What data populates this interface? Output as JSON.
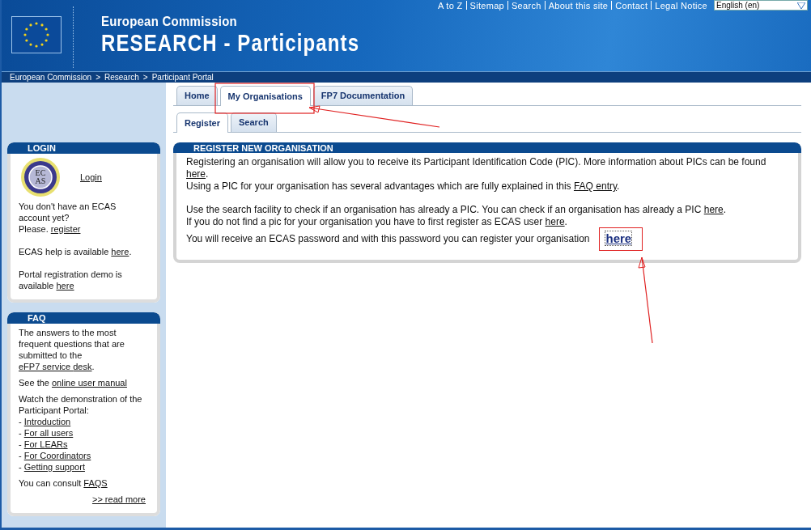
{
  "header": {
    "top_links": [
      "A to Z",
      "Sitemap",
      "Search",
      "About this site",
      "Contact",
      "Legal Notice"
    ],
    "language": "English (en)",
    "title_small": "European Commission",
    "title_large": "RESEARCH - Participants"
  },
  "breadcrumb": [
    "European Commission",
    "Research",
    "Participant Portal"
  ],
  "breadcrumb_separator": ">",
  "tabs": [
    {
      "label": "Home",
      "selected": false
    },
    {
      "label": "My Organisations",
      "selected": true
    },
    {
      "label": "FP7 Documentation",
      "selected": false
    }
  ],
  "subtabs": [
    {
      "label": "Register",
      "selected": true
    },
    {
      "label": "Search",
      "selected": false
    }
  ],
  "login": {
    "title": "LOGIN",
    "logo_text": [
      "EC",
      "AS"
    ],
    "login_link": "Login",
    "blocks": [
      [
        [
          {
            "kind": "text",
            "text": "You don't have an ECAS account yet?"
          }
        ],
        [
          {
            "kind": "text",
            "text": "Please. "
          },
          {
            "kind": "link",
            "text": "register"
          }
        ]
      ],
      [
        [
          {
            "kind": "text",
            "text": "ECAS help is available "
          },
          {
            "kind": "link",
            "text": "here"
          },
          {
            "kind": "text",
            "text": "."
          }
        ]
      ],
      [
        [
          {
            "kind": "text",
            "text": "Portal registration demo is available "
          },
          {
            "kind": "link",
            "text": "here"
          }
        ]
      ]
    ]
  },
  "faq": {
    "title": "FAQ",
    "blocks": [
      [
        [
          {
            "kind": "text",
            "text": "The answers to the most frequent questions that are submitted to the "
          },
          {
            "kind": "link",
            "text": "eFP7 service "
          },
          {
            "kind": "link",
            "text": "desk"
          },
          {
            "kind": "text",
            "text": "."
          }
        ]
      ],
      [
        [
          {
            "kind": "text",
            "text": "See the "
          },
          {
            "kind": "link",
            "text": "online user manual"
          }
        ]
      ],
      [
        [
          {
            "kind": "text",
            "text": "Watch the demonstration of the Participant Portal:"
          }
        ],
        [
          {
            "kind": "text",
            "text": "- "
          },
          {
            "kind": "link",
            "text": "Introduction"
          }
        ],
        [
          {
            "kind": "text",
            "text": "- "
          },
          {
            "kind": "link",
            "text": "For all users"
          }
        ],
        [
          {
            "kind": "text",
            "text": "- "
          },
          {
            "kind": "link",
            "text": "For LEARs"
          }
        ],
        [
          {
            "kind": "text",
            "text": "- "
          },
          {
            "kind": "link",
            "text": "For Coordinators"
          }
        ],
        [
          {
            "kind": "text",
            "text": "- "
          },
          {
            "kind": "link",
            "text": "Getting support"
          }
        ]
      ],
      [
        [
          {
            "kind": "text",
            "text": "You can consult "
          },
          {
            "kind": "link",
            "text": "FAQS"
          }
        ]
      ]
    ],
    "read_more": ">> read more"
  },
  "panel": {
    "title": "REGISTER NEW ORGANISATION",
    "blocks": [
      [
        [
          {
            "kind": "text",
            "text": "Registering an organisation will allow you to receive its Participant Identification Code (PIC). More information about PICs can be found "
          },
          {
            "kind": "link",
            "text": "here"
          },
          {
            "kind": "text",
            "text": "."
          }
        ],
        [
          {
            "kind": "text",
            "text": "Using a PIC for your organisation has several advantages which are fully explained in this "
          },
          {
            "kind": "link",
            "text": "FAQ entry"
          },
          {
            "kind": "text",
            "text": "."
          }
        ]
      ],
      [
        [
          {
            "kind": "text",
            "text": "Use the search facility to check if an organisation has already a PIC. You can check if an organisation has already a PIC "
          },
          {
            "kind": "link",
            "text": "here"
          },
          {
            "kind": "text",
            "text": "."
          }
        ],
        [
          {
            "kind": "text",
            "text": "If you do not find a pic for your organisation you have to first register as ECAS user  "
          },
          {
            "kind": "link",
            "text": "here"
          },
          {
            "kind": "text",
            "text": "."
          }
        ]
      ],
      [
        [
          {
            "kind": "text",
            "text": "You will receive an ECAS password and with this password you can register your organisation "
          },
          {
            "kind": "big_link",
            "text": "here"
          }
        ]
      ]
    ]
  }
}
